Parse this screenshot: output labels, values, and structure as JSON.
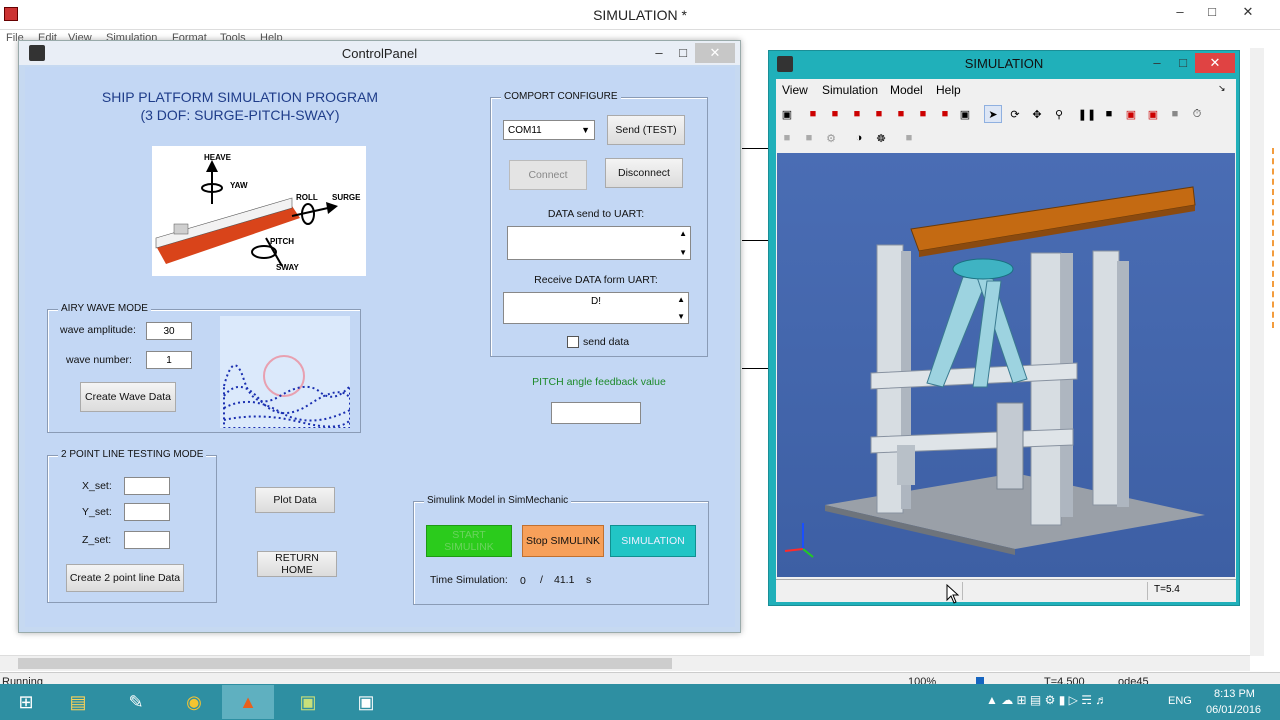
{
  "main_window": {
    "title": "SIMULATION *",
    "menu": [
      "File",
      "Edit",
      "View",
      "Simulation",
      "Format",
      "Tools",
      "Help"
    ],
    "status": {
      "left": "Running",
      "zoom": "100%",
      "time": "T=4.500",
      "solver": "ode45"
    }
  },
  "control_panel": {
    "title": "ControlPanel",
    "heading_line1": "SHIP PLATFORM SIMULATION PROGRAM",
    "heading_line2": "(3 DOF: SURGE-PITCH-SWAY)",
    "ship_labels": {
      "heave": "HEAVE",
      "yaw": "YAW",
      "roll": "ROLL",
      "surge": "SURGE",
      "pitch": "PITCH",
      "sway": "SWAY"
    },
    "airy": {
      "legend": "AIRY WAVE MODE",
      "amp_label": "wave amplitude:",
      "amp_value": "30",
      "num_label": "wave number:",
      "num_value": "1",
      "button": "Create Wave Data"
    },
    "line": {
      "legend": "2 POINT LINE TESTING MODE",
      "x_label": "X_set:",
      "y_label": "Y_set:",
      "z_label": "Z_set:",
      "x_value": "",
      "y_value": "",
      "z_value": "",
      "button": "Create 2 point line Data"
    },
    "plot_button": "Plot Data",
    "return_button": "RETURN HOME",
    "comport": {
      "legend": "COMPORT CONFIGURE",
      "com_value": "COM11",
      "send_test": "Send (TEST)",
      "connect": "Connect",
      "disconnect": "Disconnect",
      "send_label": "DATA send to UART:",
      "send_value": "",
      "recv_label": "Receive DATA form UART:",
      "recv_value": "D!",
      "checkbox_label": "send data"
    },
    "pitch_label": "PITCH angle feedback value",
    "pitch_value": "",
    "simulink": {
      "legend": "Simulink Model in SimMechanic",
      "start": "START SIMULINK",
      "stop": "Stop SIMULINK",
      "simulation": "SIMULATION",
      "time_label": "Time Simulation:",
      "time_current": "0",
      "time_sep": "/",
      "time_total": "41.1",
      "time_unit": "s"
    }
  },
  "sim_window": {
    "title": "SIMULATION",
    "menu": [
      "View",
      "Simulation",
      "Model",
      "Help"
    ],
    "status_time": "T=5.4"
  },
  "taskbar": {
    "lang": "ENG",
    "time": "8:13 PM",
    "date": "06/01/2016"
  }
}
